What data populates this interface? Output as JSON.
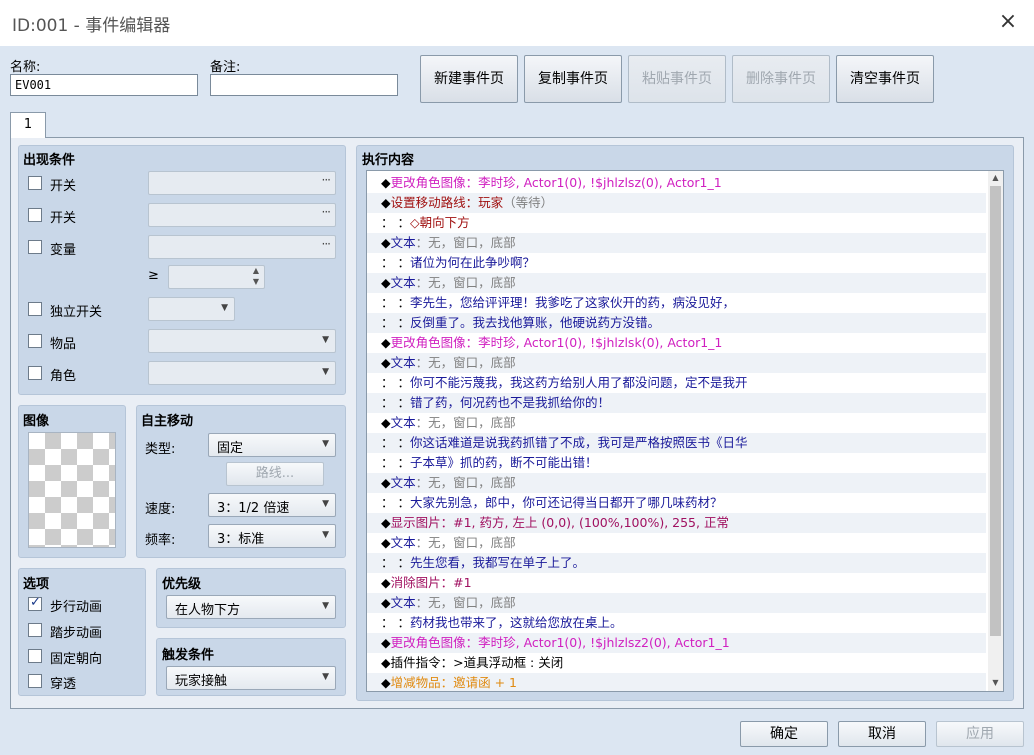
{
  "window": {
    "title": "ID:001 - 事件编辑器",
    "close_icon": "×"
  },
  "name": {
    "label": "名称:",
    "value": "EV001"
  },
  "note": {
    "label": "备注:",
    "value": ""
  },
  "toolbar": {
    "new_page": "新建事件页",
    "copy_page": "复制事件页",
    "paste_page": "粘贴事件页",
    "delete_page": "删除事件页",
    "clear_page": "清空事件页"
  },
  "tabs": [
    {
      "label": "1"
    }
  ],
  "conditions": {
    "title": "出现条件",
    "switch1": "开关",
    "switch2": "开关",
    "variable": "变量",
    "gte": "≥",
    "self_switch": "独立开关",
    "item": "物品",
    "actor": "角色",
    "dots": "···"
  },
  "image": {
    "title": "图像"
  },
  "autonomous": {
    "title": "自主移动",
    "type_label": "类型:",
    "type_value": "固定",
    "route_button": "路线...",
    "speed_label": "速度:",
    "speed_value": "3：1/2 倍速",
    "freq_label": "频率:",
    "freq_value": "3：标准"
  },
  "options": {
    "title": "选项",
    "walking": "步行动画",
    "stepping": "踏步动画",
    "direction_fix": "固定朝向",
    "through": "穿透",
    "walking_checked": true
  },
  "priority": {
    "title": "优先级",
    "value": "在人物下方"
  },
  "trigger": {
    "title": "触发条件",
    "value": "玩家接触"
  },
  "contents": {
    "title": "执行内容",
    "rows": [
      {
        "segs": [
          {
            "t": "◆",
            "c": "#000000"
          },
          {
            "t": "更改角色图像：李时珍, Actor1(0), !$jhlzlsz(0), Actor1_1",
            "c": "#d020c0"
          }
        ]
      },
      {
        "segs": [
          {
            "t": "◆",
            "c": "#000000"
          },
          {
            "t": "设置移动路线：",
            "c": "#a01010"
          },
          {
            "t": "玩家",
            "c": "#a01010"
          },
          {
            "t": "（等待）",
            "c": "#808080"
          }
        ]
      },
      {
        "segs": [
          {
            "t": "：            ：",
            "c": "#000000"
          },
          {
            "t": "◇朝向下方",
            "c": "#a01010"
          }
        ]
      },
      {
        "segs": [
          {
            "t": "◆",
            "c": "#000000"
          },
          {
            "t": "文本",
            "c": "#1a1a9a"
          },
          {
            "t": "：无，窗口，底部",
            "c": "#808080"
          }
        ]
      },
      {
        "segs": [
          {
            "t": "：      ：",
            "c": "#000000"
          },
          {
            "t": "诸位为何在此争吵啊？",
            "c": "#1a1a9a"
          }
        ]
      },
      {
        "segs": [
          {
            "t": "◆",
            "c": "#000000"
          },
          {
            "t": "文本",
            "c": "#1a1a9a"
          },
          {
            "t": "：无，窗口，底部",
            "c": "#808080"
          }
        ]
      },
      {
        "segs": [
          {
            "t": "：      ：",
            "c": "#000000"
          },
          {
            "t": "李先生，您给评评理！我爹吃了这家伙开的药，病没见好，",
            "c": "#1a1a9a"
          }
        ]
      },
      {
        "segs": [
          {
            "t": "：      ：",
            "c": "#000000"
          },
          {
            "t": "反倒重了。我去找他算账，他硬说药方没错。",
            "c": "#1a1a9a"
          }
        ]
      },
      {
        "segs": [
          {
            "t": "◆",
            "c": "#000000"
          },
          {
            "t": "更改角色图像：李时珍, Actor1(0), !$jhlzlsk(0), Actor1_1",
            "c": "#d020c0"
          }
        ]
      },
      {
        "segs": [
          {
            "t": "◆",
            "c": "#000000"
          },
          {
            "t": "文本",
            "c": "#1a1a9a"
          },
          {
            "t": "：无，窗口，底部",
            "c": "#808080"
          }
        ]
      },
      {
        "segs": [
          {
            "t": "：      ：",
            "c": "#000000"
          },
          {
            "t": "你可不能污蔑我，我这药方给别人用了都没问题，定不是我开",
            "c": "#1a1a9a"
          }
        ]
      },
      {
        "segs": [
          {
            "t": "：      ：",
            "c": "#000000"
          },
          {
            "t": "错了药，何况药也不是我抓给你的！",
            "c": "#1a1a9a"
          }
        ]
      },
      {
        "segs": [
          {
            "t": "◆",
            "c": "#000000"
          },
          {
            "t": "文本",
            "c": "#1a1a9a"
          },
          {
            "t": "：无，窗口，底部",
            "c": "#808080"
          }
        ]
      },
      {
        "segs": [
          {
            "t": "：      ：",
            "c": "#000000"
          },
          {
            "t": "你这话难道是说我药抓错了不成，我可是严格按照医书《日华",
            "c": "#1a1a9a"
          }
        ]
      },
      {
        "segs": [
          {
            "t": "：      ：",
            "c": "#000000"
          },
          {
            "t": "子本草》抓的药，断不可能出错！",
            "c": "#1a1a9a"
          }
        ]
      },
      {
        "segs": [
          {
            "t": "◆",
            "c": "#000000"
          },
          {
            "t": "文本",
            "c": "#1a1a9a"
          },
          {
            "t": "：无，窗口，底部",
            "c": "#808080"
          }
        ]
      },
      {
        "segs": [
          {
            "t": "：      ：",
            "c": "#000000"
          },
          {
            "t": "大家先别急，郎中，你可还记得当日都开了哪几味药材？",
            "c": "#1a1a9a"
          }
        ]
      },
      {
        "segs": [
          {
            "t": "◆",
            "c": "#000000"
          },
          {
            "t": "显示图片：#1, 药方, 左上 (0,0), (100%,100%), 255, 正常",
            "c": "#a01060"
          }
        ]
      },
      {
        "segs": [
          {
            "t": "◆",
            "c": "#000000"
          },
          {
            "t": "文本",
            "c": "#1a1a9a"
          },
          {
            "t": "：无，窗口，底部",
            "c": "#808080"
          }
        ]
      },
      {
        "segs": [
          {
            "t": "：      ：",
            "c": "#000000"
          },
          {
            "t": "先生您看，我都写在单子上了。",
            "c": "#1a1a9a"
          }
        ]
      },
      {
        "segs": [
          {
            "t": "◆",
            "c": "#000000"
          },
          {
            "t": "消除图片：#1",
            "c": "#a01060"
          }
        ]
      },
      {
        "segs": [
          {
            "t": "◆",
            "c": "#000000"
          },
          {
            "t": "文本",
            "c": "#1a1a9a"
          },
          {
            "t": "：无，窗口，底部",
            "c": "#808080"
          }
        ]
      },
      {
        "segs": [
          {
            "t": "：      ：",
            "c": "#000000"
          },
          {
            "t": "药材我也带来了，这就给您放在桌上。",
            "c": "#1a1a9a"
          }
        ]
      },
      {
        "segs": [
          {
            "t": "◆",
            "c": "#000000"
          },
          {
            "t": "更改角色图像：李时珍, Actor1(0), !$jhlzlsz2(0), Actor1_1",
            "c": "#d020c0"
          }
        ]
      },
      {
        "segs": [
          {
            "t": "◆插件指令：>道具浮动框 : 关闭",
            "c": "#000000"
          }
        ]
      },
      {
        "segs": [
          {
            "t": "◆",
            "c": "#000000"
          },
          {
            "t": "增减物品：邀请函 + 1",
            "c": "#e08a10"
          }
        ]
      }
    ]
  },
  "footer": {
    "ok": "确定",
    "cancel": "取消",
    "apply": "应用"
  }
}
